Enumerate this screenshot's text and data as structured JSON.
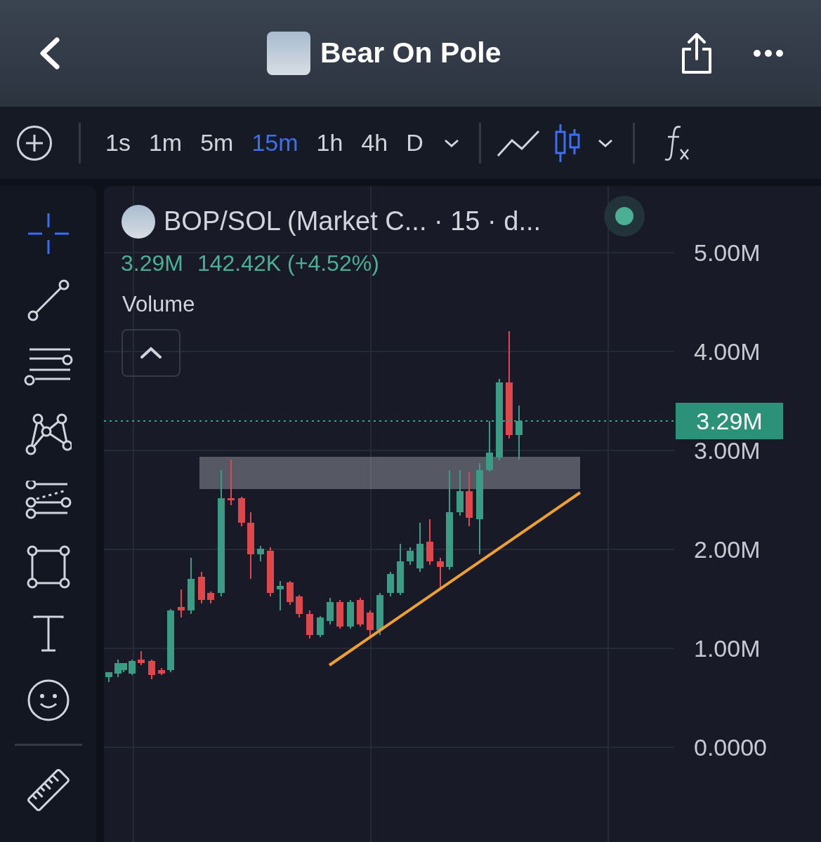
{
  "header": {
    "title": "Bear On Pole"
  },
  "toolbar": {
    "intervals": [
      {
        "label": "1s",
        "selected": false
      },
      {
        "label": "1m",
        "selected": false
      },
      {
        "label": "5m",
        "selected": false
      },
      {
        "label": "15m",
        "selected": true
      },
      {
        "label": "1h",
        "selected": false
      },
      {
        "label": "4h",
        "selected": false
      },
      {
        "label": "D",
        "selected": false
      }
    ],
    "chart_styles": [
      {
        "kind": "line",
        "selected": false
      },
      {
        "kind": "candles",
        "selected": true
      }
    ]
  },
  "drawing_tools": [
    {
      "kind": "crosshair",
      "selected": true
    },
    {
      "kind": "trend-line",
      "selected": false
    },
    {
      "kind": "fib",
      "selected": false
    },
    {
      "kind": "pattern",
      "selected": false
    },
    {
      "kind": "forecast",
      "selected": false
    },
    {
      "kind": "rectangle",
      "selected": false
    },
    {
      "kind": "text",
      "selected": false
    },
    {
      "kind": "emoji",
      "selected": false
    },
    {
      "kind": "ruler",
      "selected": false
    }
  ],
  "chart": {
    "symbol": "BOP/SOL (Market C... · 15 · d...",
    "live": true,
    "last": "3.29M",
    "change": "142.42K (+4.52%)",
    "indicator": "Volume",
    "y_axis": [
      "5.00M",
      "4.00M",
      "3.00M",
      "2.00M",
      "1.00M",
      "0.0000"
    ],
    "price_tag": "3.29M"
  }
}
